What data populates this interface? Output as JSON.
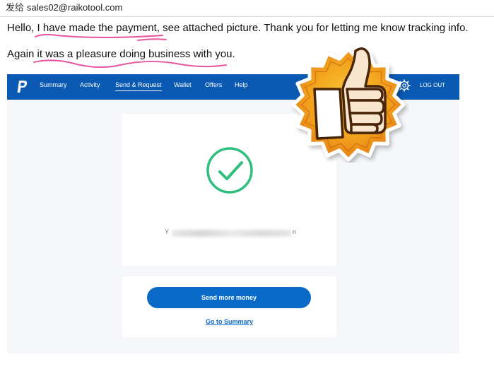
{
  "email": {
    "from_label": "发给",
    "to_address": "sales02@raikotool.com",
    "body_line_1": "Hello, I have made the payment, see attached picture. Thank you for letting me know tracking info.",
    "body_line_2": "Again it was a pleasure doing business with you.",
    "highlight_color": "#e8559e"
  },
  "paypal": {
    "nav_bg": "#0a59b3",
    "nav_items": [
      "Summary",
      "Activity",
      "Send & Request",
      "Wallet",
      "Offers",
      "Help"
    ],
    "active_item": "Send & Request",
    "logout_label": "LOG OUT",
    "success_color": "#2ebf7d",
    "recipient_first_char": "Y",
    "recipient_last_char": "n",
    "send_more_label": "Send more money",
    "go_to_summary_label": "Go to Summary",
    "button_color": "#0a6ac8"
  },
  "sticker": {
    "icon": "thumbs-up-icon",
    "badge_colors": [
      "#f6b318",
      "#e6811a"
    ]
  }
}
